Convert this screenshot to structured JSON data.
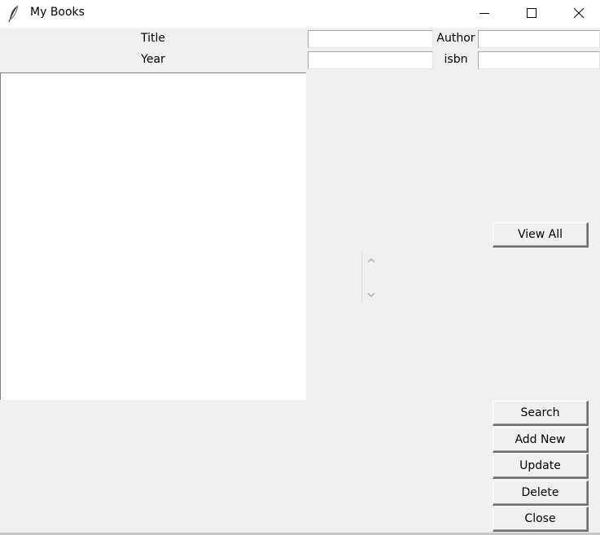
{
  "window": {
    "title": "My Books",
    "icon": "feather-icon",
    "controls": [
      "minimize-icon",
      "maximize-icon",
      "close-icon"
    ]
  },
  "form": {
    "title_label": "Title",
    "author_label": "Author",
    "year_label": "Year",
    "isbn_label": "isbn",
    "title_value": "",
    "author_value": "",
    "year_value": "",
    "isbn_value": ""
  },
  "results": {
    "items": []
  },
  "buttons": {
    "view_all": "View All",
    "search": "Search",
    "add_new": "Add New",
    "update": "Update",
    "delete": "Delete",
    "close": "Close"
  }
}
